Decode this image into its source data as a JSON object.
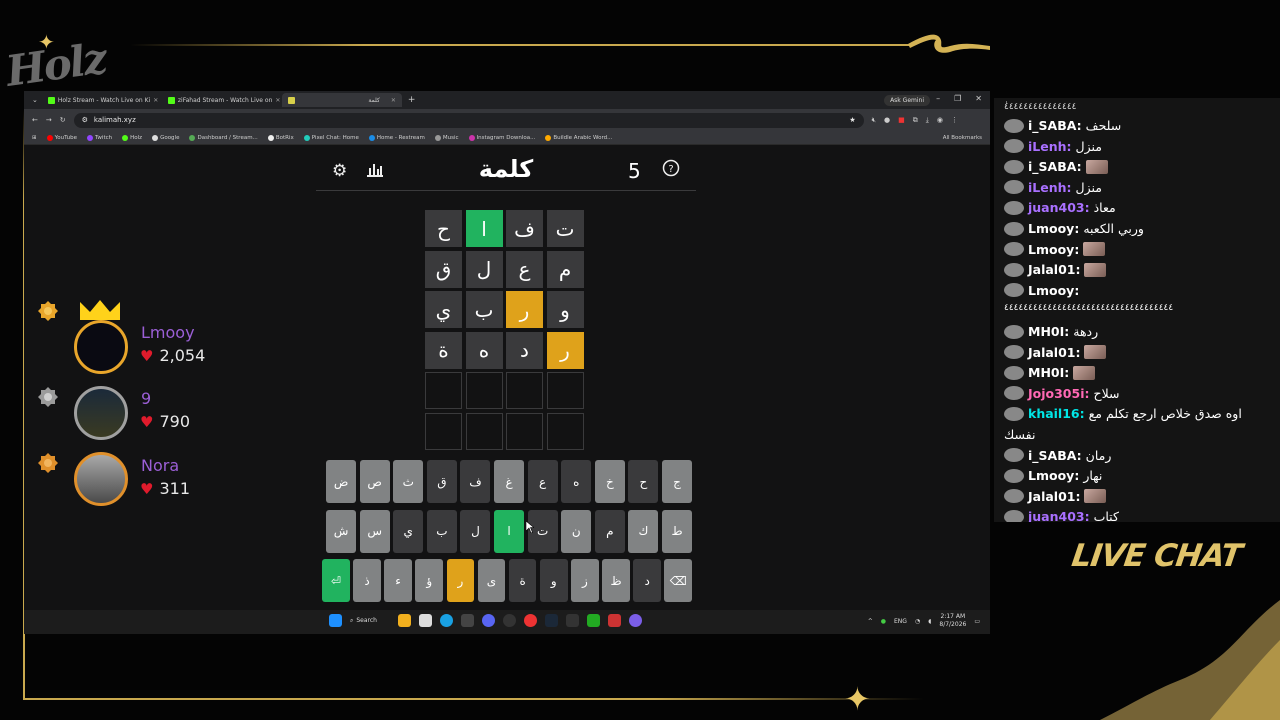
{
  "browser": {
    "tabs": [
      {
        "title": "Holz Stream - Watch Live on Ki"
      },
      {
        "title": "ziFahad Stream - Watch Live on"
      },
      {
        "title": "كلمة"
      }
    ],
    "ask_gemini": "Ask Gemini",
    "url": "kalimah.xyz",
    "bookmarks": [
      "YouTube",
      "Twitch",
      "Holz",
      "Google",
      "Dashboard / Stream...",
      "BotRix",
      "Pixel Chat: Home",
      "Home - Restream",
      "Music",
      "Instagram Downloa...",
      "Buildle Arabic Word..."
    ],
    "all_bookmarks": "All Bookmarks"
  },
  "game": {
    "title": "كلمة",
    "streak": "5",
    "grid": [
      [
        {
          "l": "ت",
          "s": "filled"
        },
        {
          "l": "ف",
          "s": "filled"
        },
        {
          "l": "ا",
          "s": "correct"
        },
        {
          "l": "ح",
          "s": "filled"
        }
      ],
      [
        {
          "l": "م",
          "s": "filled"
        },
        {
          "l": "ع",
          "s": "filled"
        },
        {
          "l": "ل",
          "s": "filled"
        },
        {
          "l": "ق",
          "s": "filled"
        }
      ],
      [
        {
          "l": "و",
          "s": "filled"
        },
        {
          "l": "ر",
          "s": "present"
        },
        {
          "l": "ب",
          "s": "filled"
        },
        {
          "l": "ي",
          "s": "filled"
        }
      ],
      [
        {
          "l": "ر",
          "s": "present"
        },
        {
          "l": "د",
          "s": "filled"
        },
        {
          "l": "ه",
          "s": "filled"
        },
        {
          "l": "ة",
          "s": "filled"
        }
      ],
      [
        {
          "l": "",
          "s": "empty"
        },
        {
          "l": "",
          "s": "empty"
        },
        {
          "l": "",
          "s": "empty"
        },
        {
          "l": "",
          "s": "empty"
        }
      ],
      [
        {
          "l": "",
          "s": "empty"
        },
        {
          "l": "",
          "s": "empty"
        },
        {
          "l": "",
          "s": "empty"
        },
        {
          "l": "",
          "s": "empty"
        }
      ]
    ],
    "keyboard": [
      [
        {
          "k": "ج",
          "s": "unused"
        },
        {
          "k": "ح",
          "s": "used"
        },
        {
          "k": "خ",
          "s": "unused"
        },
        {
          "k": "ه",
          "s": "used"
        },
        {
          "k": "ع",
          "s": "used"
        },
        {
          "k": "غ",
          "s": "unused"
        },
        {
          "k": "ف",
          "s": "used"
        },
        {
          "k": "ق",
          "s": "used"
        },
        {
          "k": "ث",
          "s": "unused"
        },
        {
          "k": "ص",
          "s": "unused"
        },
        {
          "k": "ض",
          "s": "unused"
        }
      ],
      [
        {
          "k": "ط",
          "s": "unused"
        },
        {
          "k": "ك",
          "s": "unused"
        },
        {
          "k": "م",
          "s": "used"
        },
        {
          "k": "ن",
          "s": "unused"
        },
        {
          "k": "ت",
          "s": "used"
        },
        {
          "k": "ا",
          "s": "correct"
        },
        {
          "k": "ل",
          "s": "used"
        },
        {
          "k": "ب",
          "s": "used"
        },
        {
          "k": "ي",
          "s": "used"
        },
        {
          "k": "س",
          "s": "unused"
        },
        {
          "k": "ش",
          "s": "unused"
        }
      ],
      [
        {
          "k": "⌫",
          "s": "unused"
        },
        {
          "k": "د",
          "s": "used"
        },
        {
          "k": "ظ",
          "s": "unused"
        },
        {
          "k": "ز",
          "s": "unused"
        },
        {
          "k": "و",
          "s": "used"
        },
        {
          "k": "ة",
          "s": "used"
        },
        {
          "k": "ى",
          "s": "unused"
        },
        {
          "k": "ر",
          "s": "present"
        },
        {
          "k": "ؤ",
          "s": "unused"
        },
        {
          "k": "ء",
          "s": "unused"
        },
        {
          "k": "ذ",
          "s": "unused"
        },
        {
          "k": "⏎",
          "s": "correct"
        }
      ]
    ]
  },
  "taskbar": {
    "search": "Search",
    "lang": "ENG",
    "time": "2:17 AM",
    "date": "8/7/2026"
  },
  "leaderboard": [
    {
      "name": "Lmooy",
      "score": "2,054",
      "name_color": "#9b5fd6",
      "medal": "gold"
    },
    {
      "name": "9",
      "score": "790",
      "name_color": "#9b5fd6",
      "medal": "silver"
    },
    {
      "name": "Nora",
      "score": "311",
      "name_color": "#9b5fd6",
      "medal": "bronze"
    }
  ],
  "chat": {
    "header": "ٰ٤٤٤٤٤٤٤٤٤٤٤٤٤٤٤",
    "messages": [
      {
        "user": "i_SABA:",
        "msg": "سلحف",
        "color": "#ffffff"
      },
      {
        "user": "iLenh:",
        "msg": "منزل",
        "color": "#a970ff"
      },
      {
        "user": "i_SABA:",
        "msg": "",
        "color": "#ffffff",
        "emote": true
      },
      {
        "user": "iLenh:",
        "msg": "منزل",
        "color": "#a970ff"
      },
      {
        "user": "juan403:",
        "msg": "معاذ",
        "color": "#a970ff"
      },
      {
        "user": "Lmooy:",
        "msg": "وربي الكعبه",
        "color": "#ffffff"
      },
      {
        "user": "Lmooy:",
        "msg": "",
        "color": "#ffffff",
        "emote": true
      },
      {
        "user": "Jalal01:",
        "msg": "",
        "color": "#ffffff",
        "emote": true
      },
      {
        "user": "Lmooy:",
        "msg": "",
        "color": "#ffffff"
      },
      {
        "user": "",
        "msg": "٤٤٤٤٤٤٤٤٤٤٤٤٤٤٤٤٤٤٤٤٤٤٤٤٤٤٤٤٤٤٤٤٤٤٤",
        "color": "#ffffff"
      },
      {
        "user": "MH0I:",
        "msg": "ردهة",
        "color": "#ffffff"
      },
      {
        "user": "Jalal01:",
        "msg": "",
        "color": "#ffffff",
        "emote": true
      },
      {
        "user": "MH0I:",
        "msg": "",
        "color": "#ffffff",
        "emote": true
      },
      {
        "user": "Jojo305i:",
        "msg": "سلاح",
        "color": "#ff69b4"
      },
      {
        "user": "khail16:",
        "msg": "اوه صدق خلاص ارجع تكلم مع",
        "color": "#00e5e5"
      },
      {
        "user": "",
        "msg": "نفسك",
        "color": "#ffffff"
      },
      {
        "user": "i_SABA:",
        "msg": "رمان",
        "color": "#ffffff"
      },
      {
        "user": "Lmooy:",
        "msg": "نهار",
        "color": "#ffffff"
      },
      {
        "user": "Jalal01:",
        "msg": "",
        "color": "#ffffff",
        "emote": true
      },
      {
        "user": "juan403:",
        "msg": "كتاب",
        "color": "#a970ff"
      }
    ],
    "label": "LIVE CHAT"
  },
  "colors": {
    "accent_gold": "#c9a94e",
    "tile_correct": "#21b35f",
    "tile_present": "#dfa21b",
    "tile_used": "#3a3a3c"
  }
}
